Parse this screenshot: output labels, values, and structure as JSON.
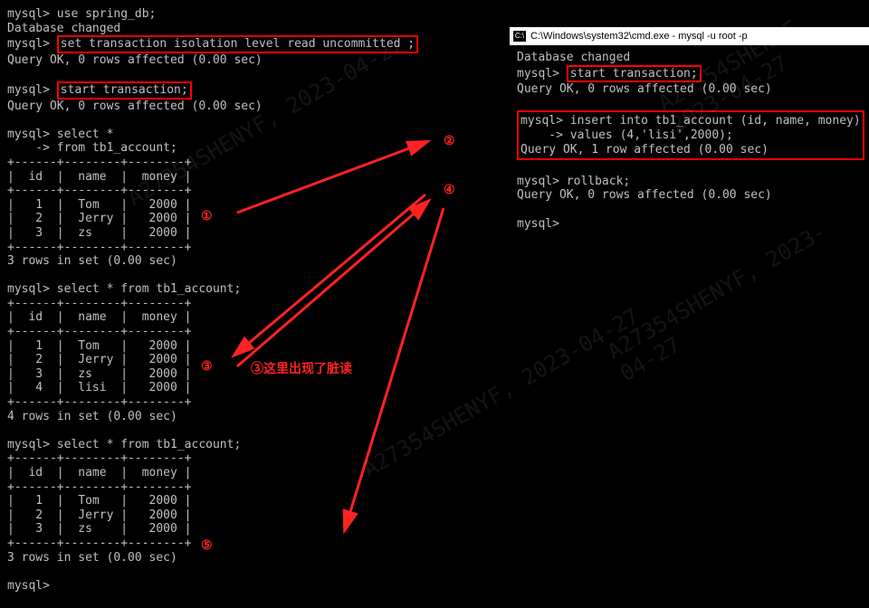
{
  "left": {
    "prompt": "mysql>",
    "cmd_use": "use spring_db;",
    "db_changed": "Database changed",
    "cmd_iso": "set transaction isolation level read uncommitted ;",
    "q0": "Query OK, 0 rows affected (0.00 sec)",
    "cmd_start": "start transaction;",
    "q1": "Query OK, 0 rows affected (0.00 sec)",
    "cmd_select1a": "select *",
    "cmd_select1b": "    -> from tb1_account;",
    "tbl_sep": "+------+--------+--------+",
    "tbl_head": "|  id  |  name  |  money |",
    "row1": "|   1  |  Tom   |   2000 |",
    "row2": "|   2  |  Jerry |   2000 |",
    "row3": "|   3  |  zs    |   2000 |",
    "row4": "|   4  |  lisi  |   2000 |",
    "rows3": "3 rows in set (0.00 sec)",
    "rows4": "4 rows in set (0.00 sec)",
    "cmd_selectfull": "select * from tb1_account;",
    "note_dirty": "③这里出现了脏读"
  },
  "right": {
    "title": "C:\\Windows\\system32\\cmd.exe - mysql -u root -p",
    "db_changed": "Database changed",
    "cmd_start": "start transaction;",
    "q0": "Query OK, 0 rows affected (0.00 sec)",
    "cmd_insert1": "insert into tb1_account (id, name, money)",
    "cmd_insert2": "    -> values (4,'lisi',2000);",
    "q1": "Query OK, 1 row affected (0.00 sec)",
    "cmd_rollback": "rollback;",
    "q2": "Query OK, 0 rows affected (0.00 sec)",
    "prompt": "mysql>"
  },
  "markers": {
    "m1": "①",
    "m2": "②",
    "m3": "③",
    "m4": "④",
    "m5": "⑤"
  },
  "watermark": "A27354SHENYF, 2023-04-27"
}
